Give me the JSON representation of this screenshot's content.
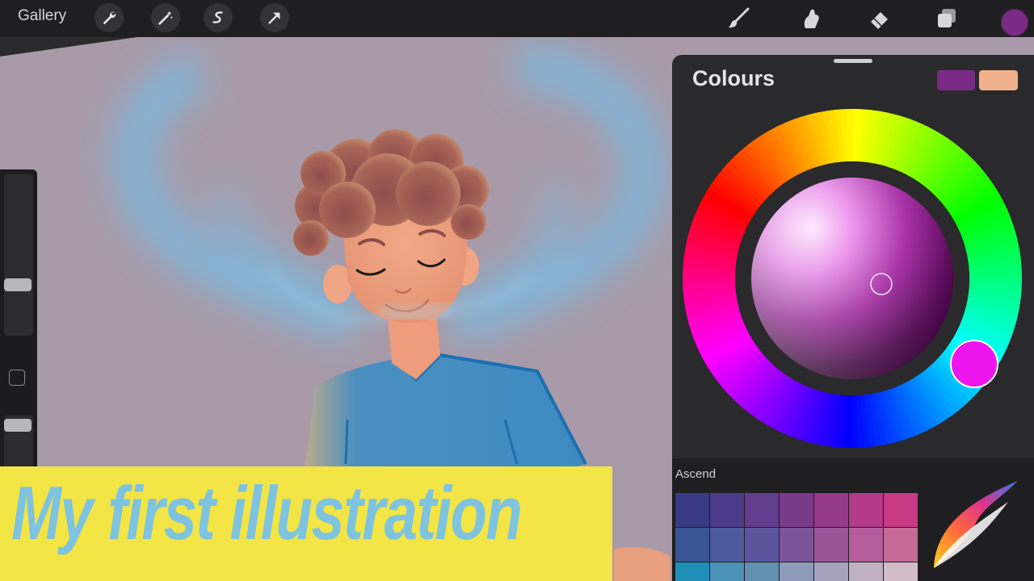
{
  "toolbar": {
    "gallery_label": "Gallery",
    "left_tools": [
      "wrench-icon",
      "magic-wand-icon",
      "selection-icon",
      "transform-arrow-icon"
    ],
    "right_tools": [
      "brush-icon",
      "smudge-icon",
      "eraser-icon",
      "layers-icon"
    ],
    "current_colour": "#7a2b86"
  },
  "colours_panel": {
    "title": "Colours",
    "primary_swatch": "#7a2b86",
    "secondary_swatch": "#f0b08c",
    "palette_name": "Ascend",
    "palette_rows": [
      [
        "#383a83",
        "#4c3a8a",
        "#613c8f",
        "#7a3a8a",
        "#973a8a",
        "#b23b8a",
        "#c83a84"
      ],
      [
        "#3a5594",
        "#4d5a9c",
        "#5a569e",
        "#7a5498",
        "#9a5598",
        "#b35d9a",
        "#c66b98"
      ],
      [
        "#1f8fb8",
        "#4a92b8",
        "#6290b0",
        "#8e9bb8",
        "#a7a3be",
        "#bfb0c4",
        "#d2bcc8"
      ]
    ]
  },
  "banner": {
    "text": "My first illustration"
  },
  "colours": {
    "banner_bg": "#f3e545",
    "banner_text": "#7ec3e0",
    "canvas_bg": "#a89aa8"
  }
}
